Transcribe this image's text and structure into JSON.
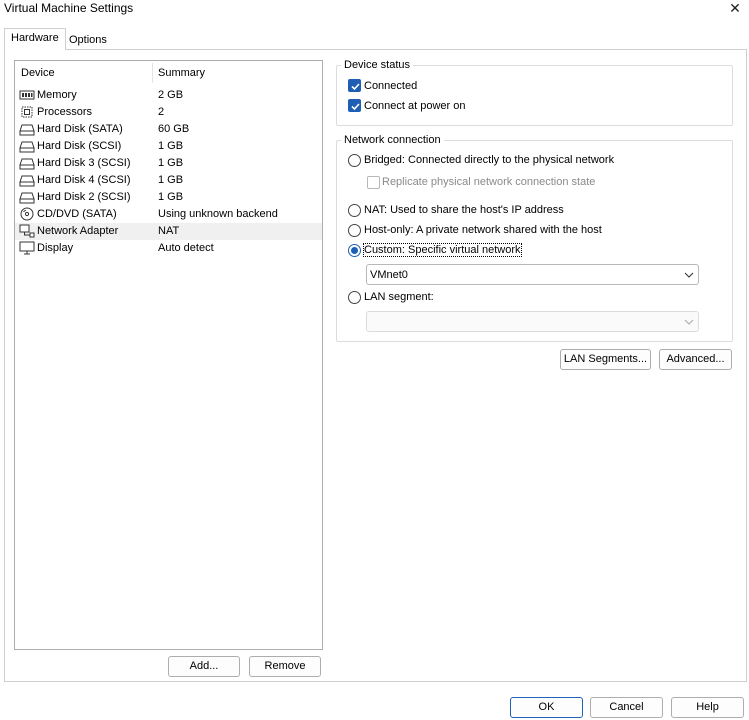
{
  "window": {
    "title": "Virtual Machine Settings",
    "close_glyph": "✕"
  },
  "tabs": [
    {
      "label": "Hardware",
      "active": true
    },
    {
      "label": "Options",
      "active": false
    }
  ],
  "device_list": {
    "columns": {
      "device": "Device",
      "summary": "Summary"
    },
    "rows": [
      {
        "icon": "memory-icon",
        "name": "Memory",
        "summary": "2 GB"
      },
      {
        "icon": "processor-icon",
        "name": "Processors",
        "summary": "2"
      },
      {
        "icon": "hard-disk-icon",
        "name": "Hard Disk (SATA)",
        "summary": "60 GB"
      },
      {
        "icon": "hard-disk-icon",
        "name": "Hard Disk (SCSI)",
        "summary": "1 GB"
      },
      {
        "icon": "hard-disk-icon",
        "name": "Hard Disk 3 (SCSI)",
        "summary": "1 GB"
      },
      {
        "icon": "hard-disk-icon",
        "name": "Hard Disk 4 (SCSI)",
        "summary": "1 GB"
      },
      {
        "icon": "hard-disk-icon",
        "name": "Hard Disk 2 (SCSI)",
        "summary": "1 GB"
      },
      {
        "icon": "cd-dvd-icon",
        "name": "CD/DVD (SATA)",
        "summary": "Using unknown backend"
      },
      {
        "icon": "network-adapter-icon",
        "name": "Network Adapter",
        "summary": "NAT",
        "selected": true
      },
      {
        "icon": "display-icon",
        "name": "Display",
        "summary": "Auto detect"
      }
    ]
  },
  "left_buttons": {
    "add": "Add...",
    "remove": "Remove"
  },
  "device_status": {
    "title": "Device status",
    "connected": {
      "label": "Connected",
      "checked": true
    },
    "connect_at_power_on": {
      "label": "Connect at power on",
      "checked": true
    }
  },
  "network_connection": {
    "title": "Network connection",
    "bridged": {
      "label": "Bridged: Connected directly to the physical network",
      "selected": false
    },
    "replicate": {
      "label": "Replicate physical network connection state",
      "checked": false,
      "disabled": true
    },
    "nat": {
      "label": "NAT: Used to share the host's IP address",
      "selected": false
    },
    "host_only": {
      "label": "Host-only: A private network shared with the host",
      "selected": false
    },
    "custom": {
      "label": "Custom: Specific virtual network",
      "selected": true
    },
    "custom_network_value": "VMnet0",
    "lan_segment": {
      "label": "LAN segment:",
      "selected": false
    },
    "lan_segment_value": ""
  },
  "right_buttons": {
    "lan_segments": "LAN Segments...",
    "advanced": "Advanced..."
  },
  "dialog_buttons": {
    "ok": "OK",
    "cancel": "Cancel",
    "help": "Help"
  },
  "colors": {
    "accent": "#1e5fb4",
    "border": "#adadad",
    "selection": "#f0f0f0",
    "disabled_text": "#8a8a8a"
  }
}
